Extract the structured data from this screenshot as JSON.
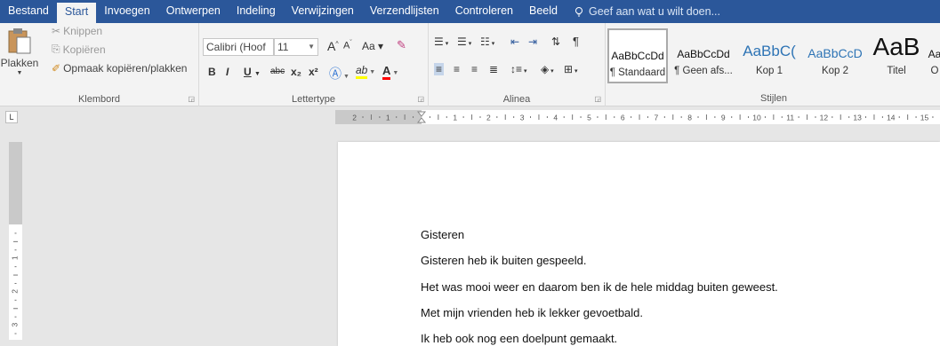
{
  "tabs": [
    "Bestand",
    "Start",
    "Invoegen",
    "Ontwerpen",
    "Indeling",
    "Verwijzingen",
    "Verzendlijsten",
    "Controleren",
    "Beeld"
  ],
  "tell_me": "Geef aan wat u wilt doen...",
  "clipboard": {
    "paste": "Plakken",
    "cut": "Knippen",
    "copy": "Kopiëren",
    "format_painter": "Opmaak kopiëren/plakken",
    "label": "Klembord"
  },
  "font": {
    "name": "Calibri (Hoof",
    "size": "11",
    "label": "Lettertype",
    "bold": "B",
    "italic": "I",
    "underline": "U",
    "strike": "abc",
    "subscript": "x₂",
    "superscript": "x²",
    "grow": "A",
    "shrink": "A",
    "case": "Aa"
  },
  "paragraph": {
    "label": "Alinea"
  },
  "styles": {
    "label": "Stijlen",
    "items": [
      {
        "preview": "AaBbCcDd",
        "name": "¶ Standaard",
        "selected": true
      },
      {
        "preview": "AaBbCcDd",
        "name": "¶ Geen afs..."
      },
      {
        "preview": "AaBbC(",
        "name": "Kop 1"
      },
      {
        "preview": "AaBbCcD",
        "name": "Kop 2"
      },
      {
        "preview": "AaB",
        "name": "Titel"
      },
      {
        "preview": "Aa",
        "name": "O"
      }
    ]
  },
  "ruler": {
    "tab_selector": "L",
    "h_ticks": [
      "2",
      "1",
      "",
      "1",
      "2",
      "3",
      "4",
      "5",
      "6",
      "7",
      "8",
      "9",
      "10",
      "11",
      "12",
      "13",
      "14",
      "15"
    ],
    "v_ticks": [
      "2",
      "1",
      "",
      "1",
      "2",
      "3"
    ]
  },
  "document": {
    "paragraphs": [
      "Gisteren",
      "Gisteren heb ik buiten gespeeld.",
      "Het was mooi weer en daarom ben ik de hele middag buiten geweest.",
      "Met mijn vrienden heb ik lekker gevoetbald.",
      "Ik heb ook nog een doelpunt gemaakt."
    ]
  },
  "colors": {
    "brand": "#2b579a",
    "highlight": "#ffff00",
    "font_color": "#ff0000"
  }
}
